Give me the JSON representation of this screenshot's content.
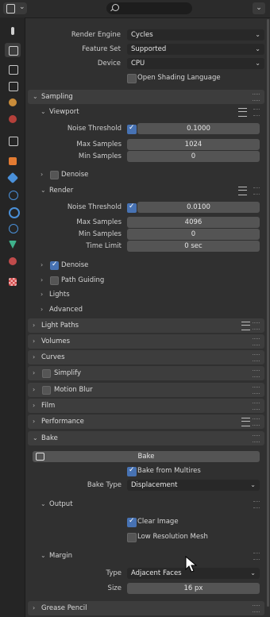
{
  "colors": {
    "accent": "#4772b3",
    "background": "#303030",
    "header": "#3d3d3d",
    "field": "#545454",
    "dropdown": "#282828"
  },
  "icons": {
    "editor_type": "properties-editor-icon",
    "search": "search-icon",
    "cursor": "mouse-cursor-icon"
  },
  "render": {
    "engine_label": "Render Engine",
    "engine_value": "Cycles",
    "feature_label": "Feature Set",
    "feature_value": "Supported",
    "device_label": "Device",
    "device_value": "CPU",
    "osl_label": "Open Shading Language"
  },
  "sampling": {
    "title": "Sampling",
    "viewport": {
      "title": "Viewport",
      "noise_label": "Noise Threshold",
      "noise_value": "0.1000",
      "max_label": "Max Samples",
      "max_value": "1024",
      "min_label": "Min Samples",
      "min_value": "0",
      "denoise_label": "Denoise"
    },
    "render": {
      "title": "Render",
      "noise_label": "Noise Threshold",
      "noise_value": "0.0100",
      "max_label": "Max Samples",
      "max_value": "4096",
      "min_label": "Min Samples",
      "min_value": "0",
      "time_label": "Time Limit",
      "time_value": "0 sec",
      "denoise_label": "Denoise"
    },
    "path_guiding": "Path Guiding",
    "lights": "Lights",
    "advanced": "Advanced"
  },
  "panels": {
    "light_paths": "Light Paths",
    "volumes": "Volumes",
    "curves": "Curves",
    "simplify": "Simplify",
    "motion_blur": "Motion Blur",
    "film": "Film",
    "performance": "Performance",
    "bake": "Bake",
    "grease_pencil": "Grease Pencil"
  },
  "bake": {
    "button_label": "Bake",
    "from_multires": "Bake from Multires",
    "type_label": "Bake Type",
    "type_value": "Displacement",
    "output_title": "Output",
    "clear_image": "Clear Image",
    "low_res": "Low Resolution Mesh",
    "margin_title": "Margin",
    "margin_type_label": "Type",
    "margin_type_value": "Adjacent Faces",
    "margin_size_label": "Size",
    "margin_size_value": "16 px"
  }
}
